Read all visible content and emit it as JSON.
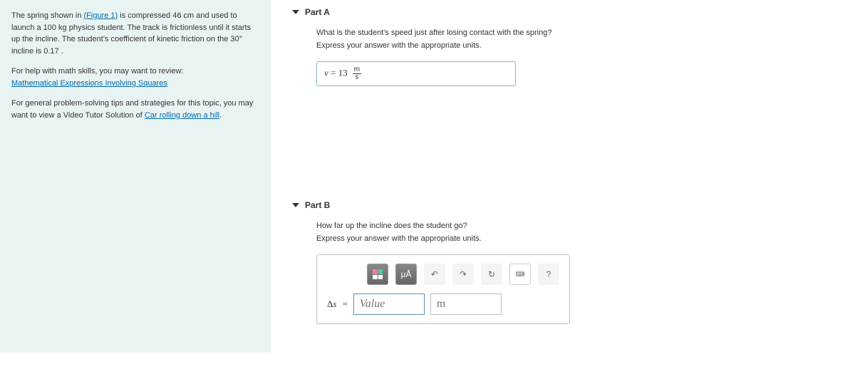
{
  "sidebar": {
    "intro1": "The spring shown in ",
    "figure_link": "(Figure 1)",
    "intro2": " is compressed 46 cm and used to launch a 100 kg physics student. The track is frictionless until it starts up the incline. The student's coefficient of kinetic friction on the 30° incline is 0.17 .",
    "help_intro": "For help with math skills, you may want to review:",
    "help_link": "Mathematical Expressions Involving Squares",
    "tips_intro": "For general problem-solving tips and strategies for this topic, you may want to view a Video Tutor Solution of ",
    "tips_link": "Car rolling down a hill",
    "tips_suffix": "."
  },
  "partA": {
    "title": "Part A",
    "question": "What is the student's speed just after losing contact with the spring?",
    "instruction": "Express your answer with the appropriate units.",
    "var": "v",
    "equals": " = ",
    "value": "13",
    "unit_top": "m",
    "unit_bot": "s"
  },
  "partB": {
    "title": "Part B",
    "question": "How far up the incline does the student go?",
    "instruction": "Express your answer with the appropriate units.",
    "toolbar": {
      "templates": "",
      "symbols": "μÅ",
      "undo": "↶",
      "redo": "↷",
      "reset": "↻",
      "keyboard": "⌨",
      "help": "?"
    },
    "var": "Δs",
    "equals": " = ",
    "value_placeholder": "Value",
    "unit_placeholder": "m"
  }
}
